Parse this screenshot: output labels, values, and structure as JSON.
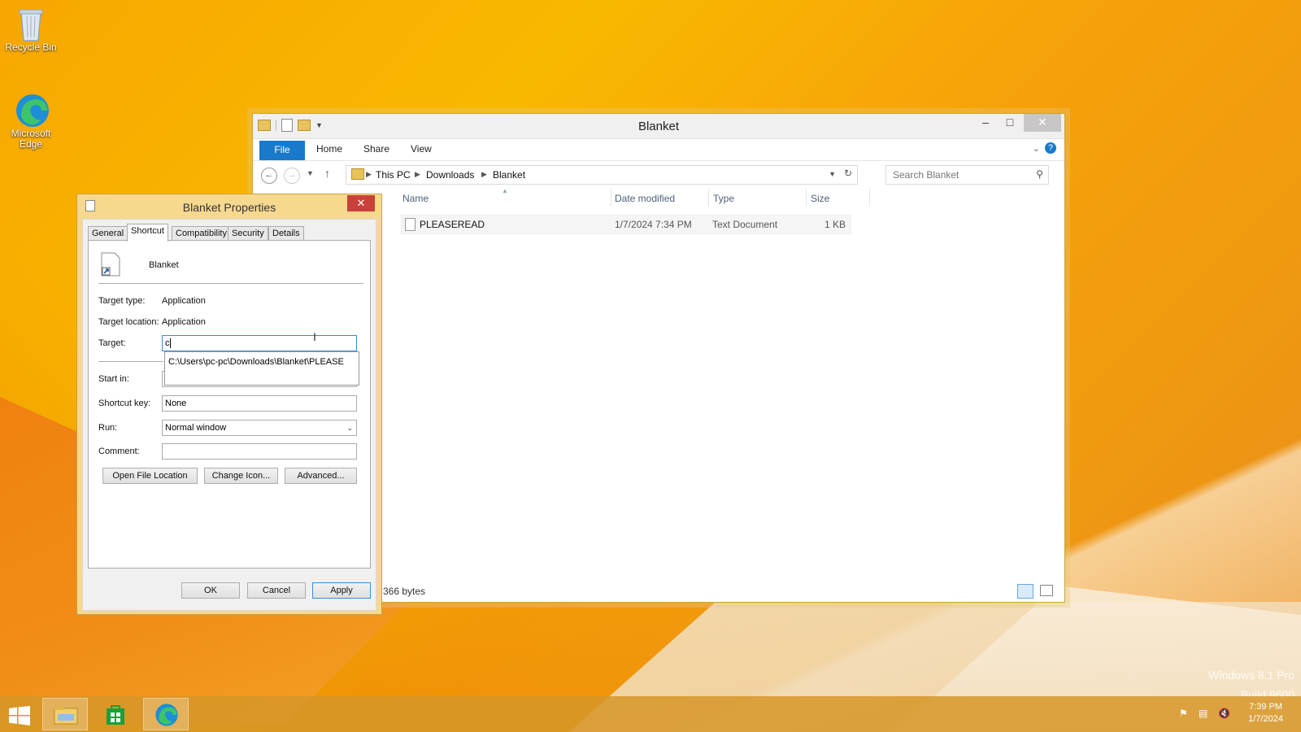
{
  "desktop": {
    "icons": [
      {
        "label": "Recycle Bin"
      },
      {
        "label": "Microsoft Edge"
      }
    ],
    "watermark": {
      "line1": "Windows 8.1 Pro",
      "line2": "Build 9600"
    }
  },
  "explorer": {
    "title": "Blanket",
    "ribbon_tabs": [
      "File",
      "Home",
      "Share",
      "View"
    ],
    "breadcrumb": [
      "This PC",
      "Downloads",
      "Blanket"
    ],
    "search_placeholder": "Search Blanket",
    "columns": [
      "Name",
      "Date modified",
      "Type",
      "Size"
    ],
    "rows": [
      {
        "name": "PLEASEREAD",
        "date": "1/7/2024 7:34 PM",
        "type": "Text Document",
        "size": "1 KB"
      }
    ],
    "status": "366 bytes"
  },
  "dialog": {
    "title": "Blanket Properties",
    "tabs": [
      "General",
      "Shortcut",
      "Compatibility",
      "Security",
      "Details"
    ],
    "active_tab": "Shortcut",
    "name": "Blanket",
    "target_type_label": "Target type:",
    "target_type": "Application",
    "target_location_label": "Target location:",
    "target_location": "Application",
    "target_label": "Target:",
    "target_value": "c",
    "suggestion": "C:\\Users\\pc-pc\\Downloads\\Blanket\\PLEASE",
    "start_in_label": "Start in:",
    "shortcut_key_label": "Shortcut key:",
    "shortcut_key": "None",
    "run_label": "Run:",
    "run_value": "Normal window",
    "comment_label": "Comment:",
    "buttons": {
      "open_location": "Open File Location",
      "change_icon": "Change Icon...",
      "advanced": "Advanced..."
    },
    "footer": {
      "ok": "OK",
      "cancel": "Cancel",
      "apply": "Apply"
    }
  },
  "taskbar": {
    "time": "7:39 PM",
    "date": "1/7/2024"
  },
  "colors": {
    "accent": "#1979ca",
    "close": "#c9413a",
    "taskbar": "#d69628"
  }
}
